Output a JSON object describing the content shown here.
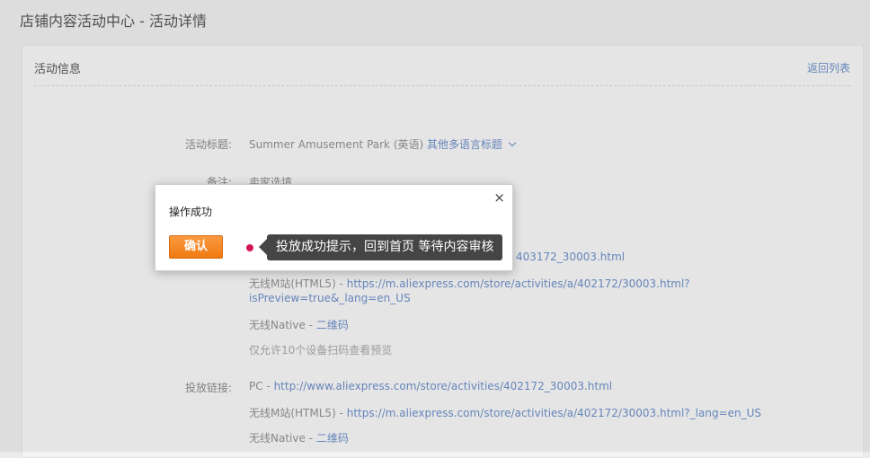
{
  "page": {
    "title": "店铺内容活动中心 - 活动详情"
  },
  "card": {
    "title": "活动信息",
    "back": "返回列表"
  },
  "fields": {
    "title_label": "活动标题:",
    "title_value": "Summer Amusement Park (英语)",
    "title_link": "其他多语言标题",
    "note_label": "备注:",
    "note_value": "卖家选填",
    "preview_pc_tail": "403172_30003.html",
    "preview_m_prefix": "无线M站(HTML5) - ",
    "preview_m_line1": "https://m.aliexpress.com/store/activities/a/402172/30003.html?",
    "preview_m_line2": "isPreview=true&_lang=en_US",
    "preview_native_prefix": "无线Native - ",
    "preview_native_link": "二维码",
    "preview_hint": "仅允许10个设备扫码查看预览",
    "launch_label": "投放链接:",
    "launch_pc_prefix": "PC - ",
    "launch_pc_link": "http://www.aliexpress.com/store/activities/402172_30003.html",
    "launch_m_prefix": "无线M站(HTML5) - ",
    "launch_m_link": "https://m.aliexpress.com/store/activities/a/402172/30003.html?_lang=en_US",
    "launch_native_prefix": "无线Native - ",
    "launch_native_link": "二维码"
  },
  "modal": {
    "title": "操作成功",
    "close": "×",
    "ok": "确认"
  },
  "tooltip": {
    "text": "投放成功提示，回到首页 等待内容审核"
  },
  "colors": {
    "link": "#6c8ec6",
    "primary_button": "#f07a12",
    "marker": "#d4145a",
    "tooltip_bg": "#454545"
  }
}
